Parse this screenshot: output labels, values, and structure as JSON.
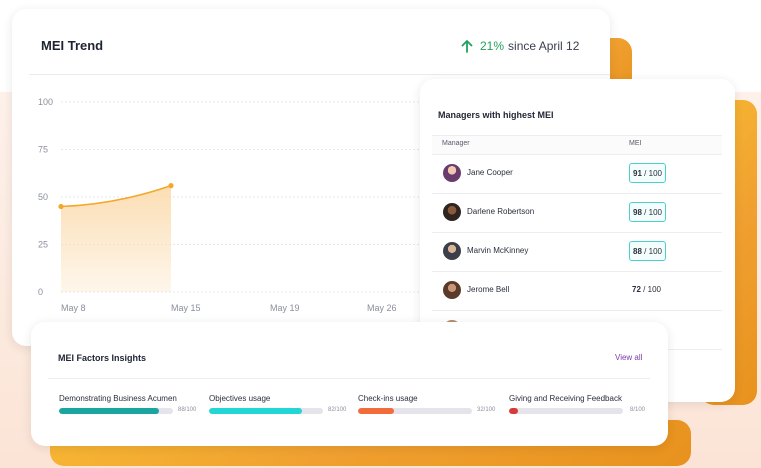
{
  "trend": {
    "title": "MEI Trend",
    "delta_pct": "21%",
    "delta_text": "since April 12",
    "colors": {
      "line": "#f2a92b",
      "fill": "#fbdcb0",
      "delta": "#23a05b"
    }
  },
  "chart_data": {
    "type": "area",
    "x": [
      "May 8",
      "May 15",
      "May 19",
      "May 26"
    ],
    "y_ticks": [
      0,
      25,
      50,
      75,
      100
    ],
    "ylim": [
      0,
      100
    ],
    "series": [
      {
        "values": [
          45,
          56
        ]
      }
    ],
    "grid": true
  },
  "managers": {
    "title": "Managers with highest MEI",
    "col_manager": "Manager",
    "col_mei": "MEI",
    "rows": [
      {
        "name": "Jane Cooper",
        "score": "91",
        "max": "/ 100",
        "highlight": true
      },
      {
        "name": "Darlene Robertson",
        "score": "98",
        "max": "/ 100",
        "highlight": true
      },
      {
        "name": "Marvin McKinney",
        "score": "88",
        "max": "/ 100",
        "highlight": true
      },
      {
        "name": "Jerome Bell",
        "score": "72",
        "max": "/ 100",
        "highlight": false
      }
    ]
  },
  "factors": {
    "title": "MEI Factors Insights",
    "view_all": "View all",
    "items": [
      {
        "label": "Demonstrating Business Acumen",
        "value": 88,
        "value_text": "88/100",
        "color": "#1aa59f"
      },
      {
        "label": "Objectives usage",
        "value": 82,
        "value_text": "82/100",
        "color": "#22d6d6"
      },
      {
        "label": "Check-ins usage",
        "value": 32,
        "value_text": "32/100",
        "color": "#f26b3a"
      },
      {
        "label": "Giving and Receiving Feedback",
        "value": 8,
        "value_text": "8/100",
        "color": "#d83a3a"
      }
    ]
  }
}
